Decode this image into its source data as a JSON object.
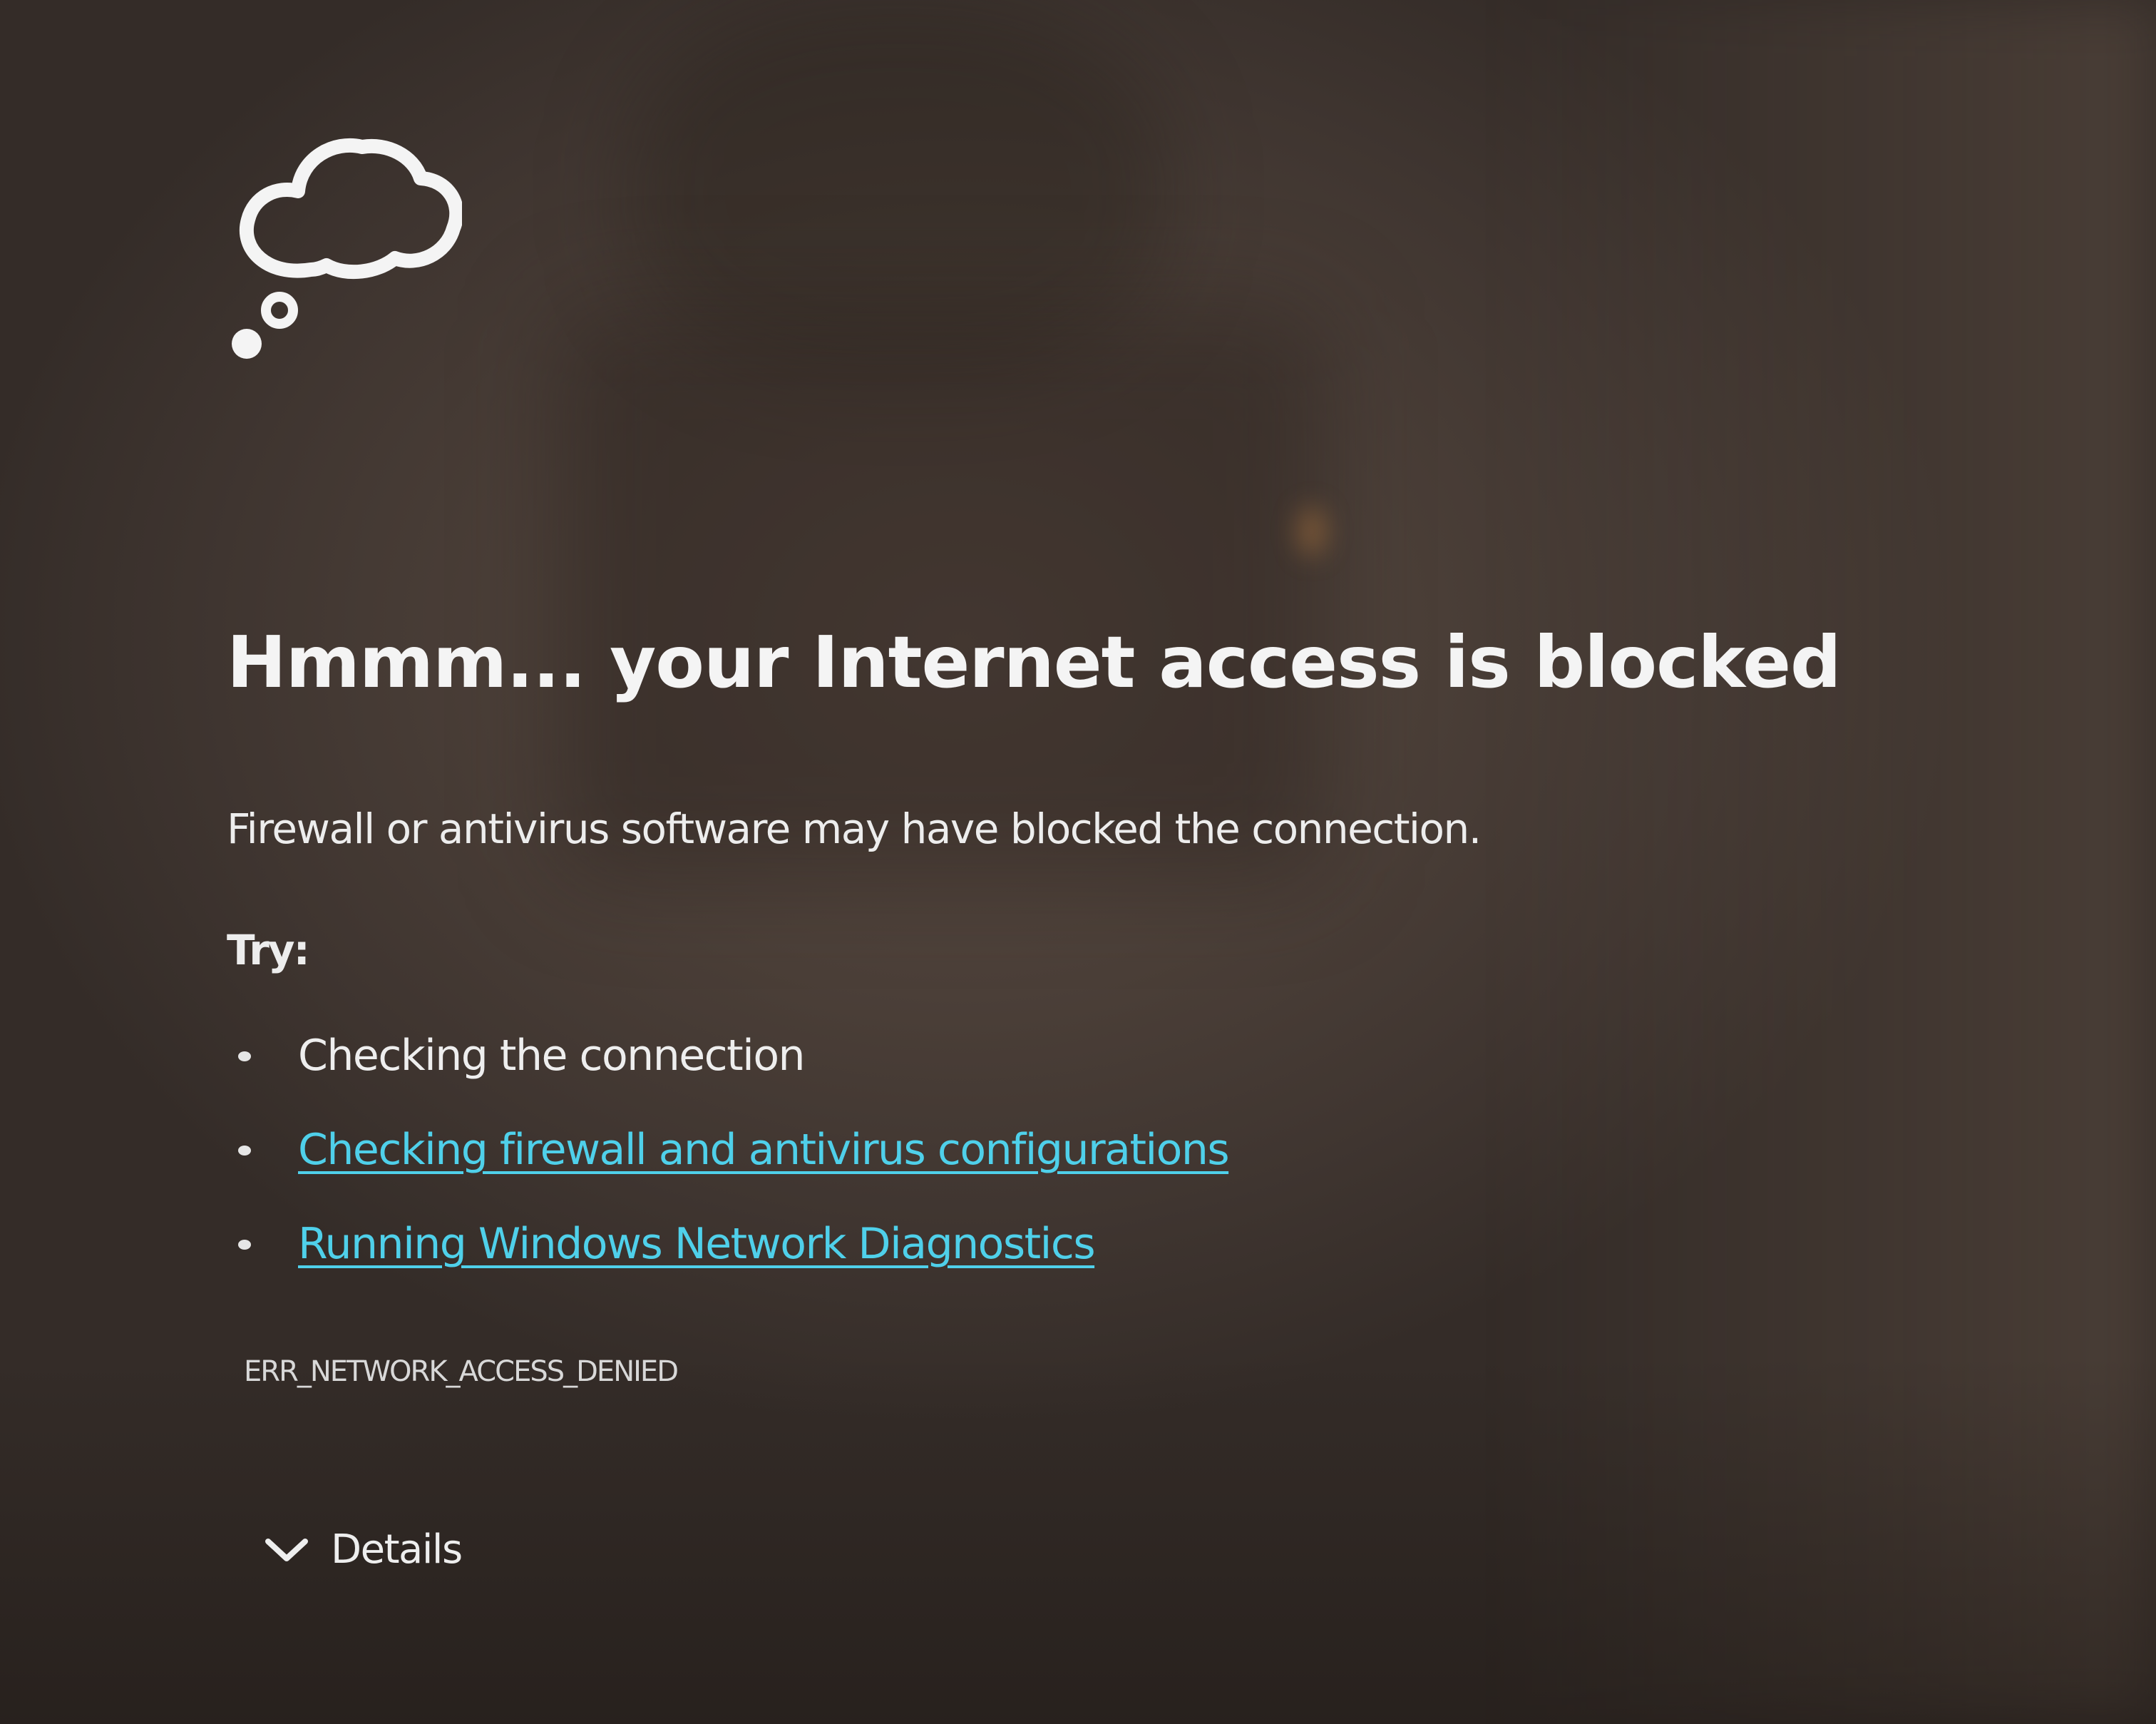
{
  "page": {
    "icon": "thought-cloud-icon",
    "title": "Hmmm... your Internet access is blocked",
    "subtitle": "Firewall or antivirus software may have blocked the connection.",
    "try_label": "Try:",
    "suggestions": [
      {
        "text": "Checking the connection",
        "is_link": false
      },
      {
        "text": "Checking firewall and antivirus configurations",
        "is_link": true
      },
      {
        "text": "Running Windows Network Diagnostics",
        "is_link": true
      }
    ],
    "error_code": "ERR_NETWORK_ACCESS_DENIED",
    "details_label": "Details",
    "details_icon": "chevron-down-icon"
  },
  "colors": {
    "link": "#4fd0ea",
    "text": "#f2f2f2",
    "background": "#4b3f38"
  }
}
